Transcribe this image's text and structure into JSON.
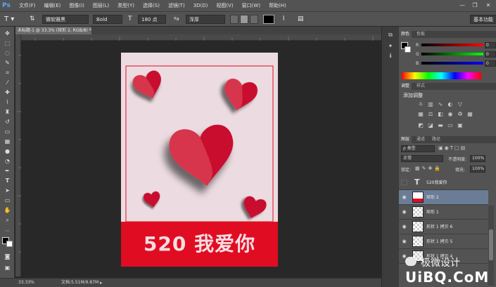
{
  "app": {
    "logo": "Ps"
  },
  "menu": [
    "文件(F)",
    "编辑(E)",
    "图像(I)",
    "图层(L)",
    "类型(Y)",
    "选择(S)",
    "滤镜(T)",
    "3D(D)",
    "视图(V)",
    "窗口(W)",
    "帮助(H)"
  ],
  "window_controls": {
    "minimize": "—",
    "restore": "❐",
    "close": "✕"
  },
  "options": {
    "font_family": "微软雅黑",
    "font_style": "Bold",
    "font_size": "180 点",
    "aa_label": "ªa",
    "aa_mode": "浑厚",
    "text_color": "#000000",
    "workspace": "基本功能"
  },
  "document": {
    "tab_title": "未标题-1 @ 33.3% (矩形 2, RGB/8) *",
    "banner_text": "520 我爱你",
    "background": "#ecdce1",
    "banner_color": "#e00d22",
    "heart_color": "#c8102e"
  },
  "status": {
    "zoom": "33.33%",
    "doc_size": "文档:5.51M/9.87M"
  },
  "panels": {
    "color": {
      "tabs": [
        "颜色",
        "色板"
      ],
      "channels": [
        {
          "label": "R",
          "value": "0"
        },
        {
          "label": "G",
          "value": "0"
        },
        {
          "label": "B",
          "value": "0"
        }
      ]
    },
    "adjustments": {
      "tabs": [
        "调整",
        "样式"
      ],
      "title": "添加调整"
    },
    "layers": {
      "tabs": [
        "图层",
        "通道",
        "路径"
      ],
      "filter": "ρ 类型",
      "blend_mode": "正常",
      "opacity_label": "不透明度:",
      "opacity_value": "100%",
      "lock_label": "锁定:",
      "fill_label": "填充:",
      "fill_value": "100%",
      "items": [
        {
          "name": "520我爱你",
          "kind": "text",
          "visible": false,
          "selected": false
        },
        {
          "name": "矩形 2",
          "kind": "shape",
          "visible": true,
          "selected": true
        },
        {
          "name": "矩形 1",
          "kind": "shape",
          "visible": true,
          "selected": false
        },
        {
          "name": "形状 1 拷贝 6",
          "kind": "shape",
          "visible": true,
          "selected": false
        },
        {
          "name": "形状 1 拷贝 5",
          "kind": "shape",
          "visible": true,
          "selected": false
        },
        {
          "name": "形状 1 拷贝 4",
          "kind": "shape",
          "visible": true,
          "selected": false
        }
      ]
    }
  },
  "watermark": {
    "brand": "极微设计",
    "site": "UiBQ.CoM"
  }
}
